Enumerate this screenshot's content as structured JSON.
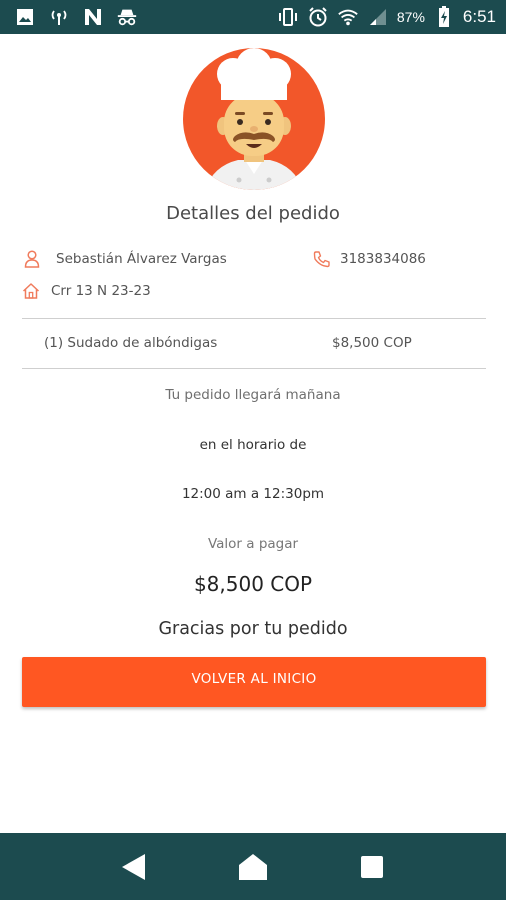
{
  "status_bar": {
    "icons": [
      "image-icon",
      "signal-antenna-icon",
      "n-icon",
      "incognito-icon",
      "vibrate-icon",
      "alarm-icon",
      "wifi-icon",
      "cell-signal-icon",
      "battery-charging-icon"
    ],
    "battery": "87%",
    "time": "6:51"
  },
  "avatar": {
    "icon": "chef-icon",
    "background_color": "#f2572a"
  },
  "page_title": "Detalles del pedido",
  "customer": {
    "name": "Sebastián Álvarez Vargas",
    "phone": "3183834086",
    "address": "Crr 13 N 23-23"
  },
  "order": {
    "items": [
      {
        "name": "(1) Sudado de albóndigas",
        "price": "$8,500 COP"
      }
    ]
  },
  "delivery": {
    "note": "Tu pedido llegará mañana",
    "schedule_label": "en el horario de",
    "schedule_time": "12:00 am a 12:30pm"
  },
  "payment": {
    "label": "Valor a pagar",
    "amount": "$8,500 COP"
  },
  "thanks": "Gracias por tu pedido",
  "home_button_label": "VOLVER AL INICIO",
  "colors": {
    "accent": "#ff5722",
    "bars": "#1c4b4f",
    "icon_accent": "#f07b5c"
  },
  "nav": [
    "back-icon",
    "home-icon",
    "recents-icon"
  ]
}
